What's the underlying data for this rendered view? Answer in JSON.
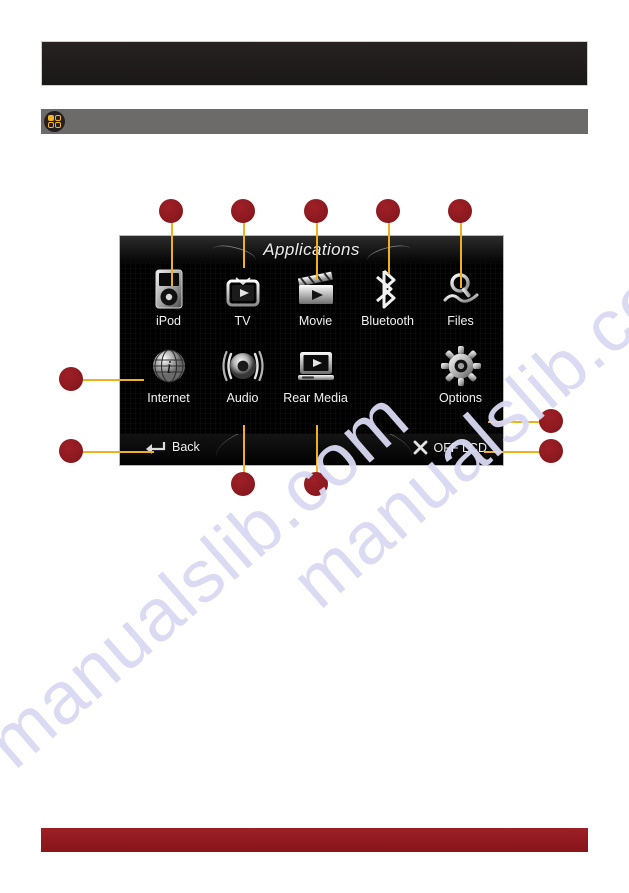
{
  "page": {
    "background_color": "#ffffff",
    "watermark_text": "manualslib.com",
    "watermark_color": "#d9d9f3"
  },
  "header": {
    "bar_color": "#201d1c",
    "title": ""
  },
  "section": {
    "bar_color": "#6d6a6a",
    "icon": "apps-grid-icon",
    "title": ""
  },
  "device": {
    "screen_title": "Applications",
    "accent_color": "#f0b019",
    "marker_color": "#8e1a20",
    "apps": [
      {
        "id": "ipod",
        "label": "iPod",
        "icon": "ipod-icon"
      },
      {
        "id": "tv",
        "label": "TV",
        "icon": "tv-icon"
      },
      {
        "id": "movie",
        "label": "Movie",
        "icon": "movie-clapper-icon"
      },
      {
        "id": "bluetooth",
        "label": "Bluetooth",
        "icon": "bluetooth-icon"
      },
      {
        "id": "files",
        "label": "Files",
        "icon": "files-search-icon"
      },
      {
        "id": "internet",
        "label": "Internet",
        "icon": "globe-internet-icon"
      },
      {
        "id": "audio",
        "label": "Audio",
        "icon": "audio-speaker-icon"
      },
      {
        "id": "rear-media",
        "label": "Rear Media",
        "icon": "rear-media-icon"
      },
      {
        "id": "options",
        "label": "Options",
        "icon": "gear-options-icon"
      }
    ],
    "nav": {
      "back_label": "Back",
      "back_icon": "back-arrow-icon",
      "off_lcd_label": "OFF LCD",
      "off_lcd_icon": "close-x-icon"
    }
  },
  "callouts": [
    {
      "id": "c-ipod",
      "target": "iPod"
    },
    {
      "id": "c-tv",
      "target": "TV"
    },
    {
      "id": "c-movie",
      "target": "Movie"
    },
    {
      "id": "c-bluetooth",
      "target": "Bluetooth"
    },
    {
      "id": "c-files",
      "target": "Files"
    },
    {
      "id": "c-internet",
      "target": "Internet"
    },
    {
      "id": "c-back",
      "target": "Back"
    },
    {
      "id": "c-options",
      "target": "Options"
    },
    {
      "id": "c-off-lcd",
      "target": "OFF LCD"
    },
    {
      "id": "c-audio",
      "target": "Audio"
    },
    {
      "id": "c-rear-media",
      "target": "Rear Media"
    }
  ],
  "footer": {
    "bar_color": "#90191f",
    "text": ""
  }
}
